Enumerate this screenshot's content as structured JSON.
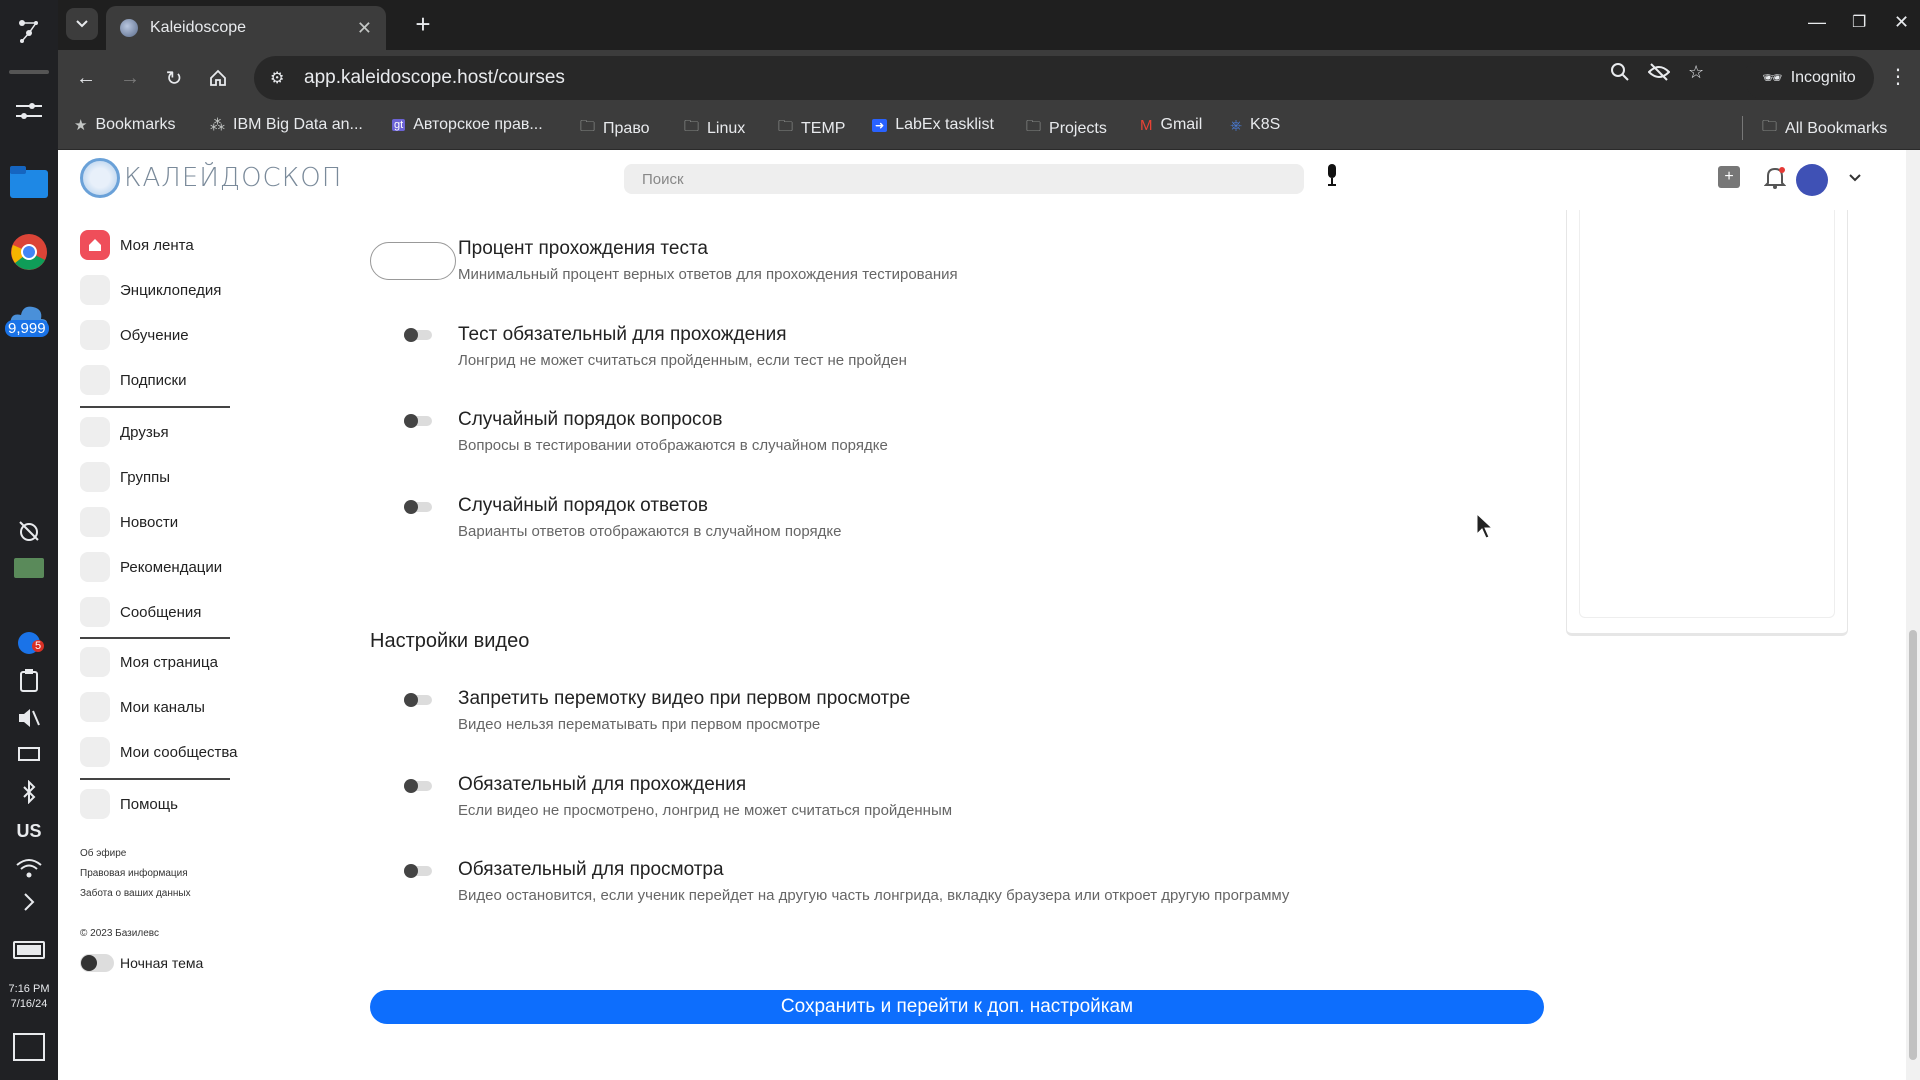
{
  "taskbar": {
    "cloud_badge": "9,999",
    "notif_badge": "5",
    "keyboard_layout": "US",
    "time": "7:16 PM",
    "date": "7/16/24"
  },
  "browser": {
    "tab_title": "Kaleidoscope",
    "url": "app.kaleidoscope.host/courses",
    "incognito_label": "Incognito",
    "bookmarks": [
      {
        "label": "Bookmarks",
        "icon": "star-icon"
      },
      {
        "label": "IBM Big Data an...",
        "icon": "site-icon"
      },
      {
        "label": "Авторское прав...",
        "icon": "gt-icon"
      },
      {
        "label": "Право",
        "icon": "folder-icon"
      },
      {
        "label": "Linux",
        "icon": "folder-icon"
      },
      {
        "label": "TEMP",
        "icon": "folder-icon"
      },
      {
        "label": "LabEx tasklist",
        "icon": "labex-icon"
      },
      {
        "label": "Projects",
        "icon": "folder-icon"
      },
      {
        "label": "Gmail",
        "icon": "gmail-icon"
      },
      {
        "label": "K8S",
        "icon": "k8s-icon"
      }
    ],
    "all_bookmarks": "All Bookmarks"
  },
  "header": {
    "logo_text": "КАЛЕЙДОСКОП",
    "search_placeholder": "Поиск"
  },
  "sidebar": {
    "items": [
      {
        "label": "Моя лента"
      },
      {
        "label": "Энциклопедия"
      },
      {
        "label": "Обучение"
      },
      {
        "label": "Подписки"
      },
      {
        "label": "Друзья"
      },
      {
        "label": "Группы"
      },
      {
        "label": "Новости"
      },
      {
        "label": "Рекомендации"
      },
      {
        "label": "Сообщения"
      },
      {
        "label": "Моя страница"
      },
      {
        "label": "Мои каналы"
      },
      {
        "label": "Мои сообщества"
      },
      {
        "label": "Помощь"
      }
    ],
    "footer_links": [
      "Об эфире",
      "Правовая информация",
      "Забота о ваших данных"
    ],
    "copyright": "© 2023 Базилевс",
    "night_theme": "Ночная тема"
  },
  "settings": {
    "test": [
      {
        "title": "Процент прохождения теста",
        "desc": "Минимальный процент верных ответов для прохождения тестирования"
      },
      {
        "title": "Тест обязательный для прохождения",
        "desc": "Лонгрид не может считаться пройденным, если тест не пройден"
      },
      {
        "title": "Случайный порядок вопросов",
        "desc": "Вопросы в тестировании отображаются в случайном порядке"
      },
      {
        "title": "Случайный порядок ответов",
        "desc": "Варианты ответов отображаются в случайном порядке"
      }
    ],
    "video_section_title": "Настройки видео",
    "video": [
      {
        "title": "Запретить перемотку видео при первом просмотре",
        "desc": "Видео нельзя перематывать при первом просмотре"
      },
      {
        "title": "Обязательный для прохождения",
        "desc": "Если видео не просмотрено, лонгрид не может считаться пройденным"
      },
      {
        "title": "Обязательный для просмотра",
        "desc": "Видео остановится, если ученик перейдет на другую часть лонгрида, вкладку браузера или откроет другую программу"
      }
    ],
    "save_button": "Сохранить и перейти к доп. настройкам"
  }
}
